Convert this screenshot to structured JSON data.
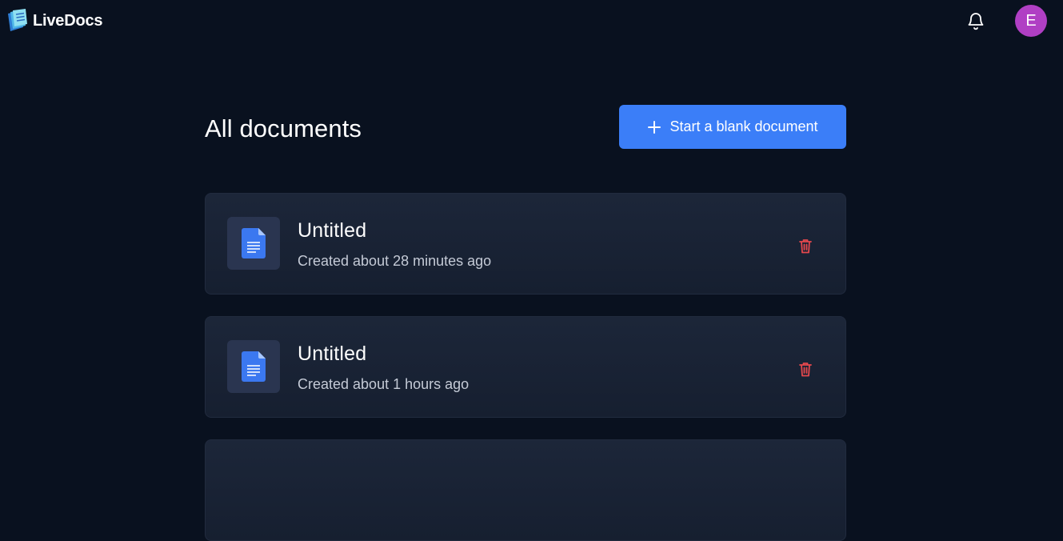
{
  "app": {
    "name": "LiveDocs"
  },
  "header": {
    "avatar_initial": "E",
    "avatar_color": "#b03fc4",
    "icons": [
      "logo-icon",
      "bell-icon"
    ]
  },
  "main": {
    "title": "All documents",
    "start_button_label": "Start a blank document",
    "start_button_color": "#3b7ef8"
  },
  "documents": [
    {
      "title": "Untitled",
      "meta": "Created about 28 minutes ago"
    },
    {
      "title": "Untitled",
      "meta": "Created about 1 hours ago"
    }
  ],
  "colors": {
    "background": "#09111f",
    "card": "#1a2335",
    "doc_icon": "#3b78f0",
    "delete_icon": "#e5484d"
  }
}
